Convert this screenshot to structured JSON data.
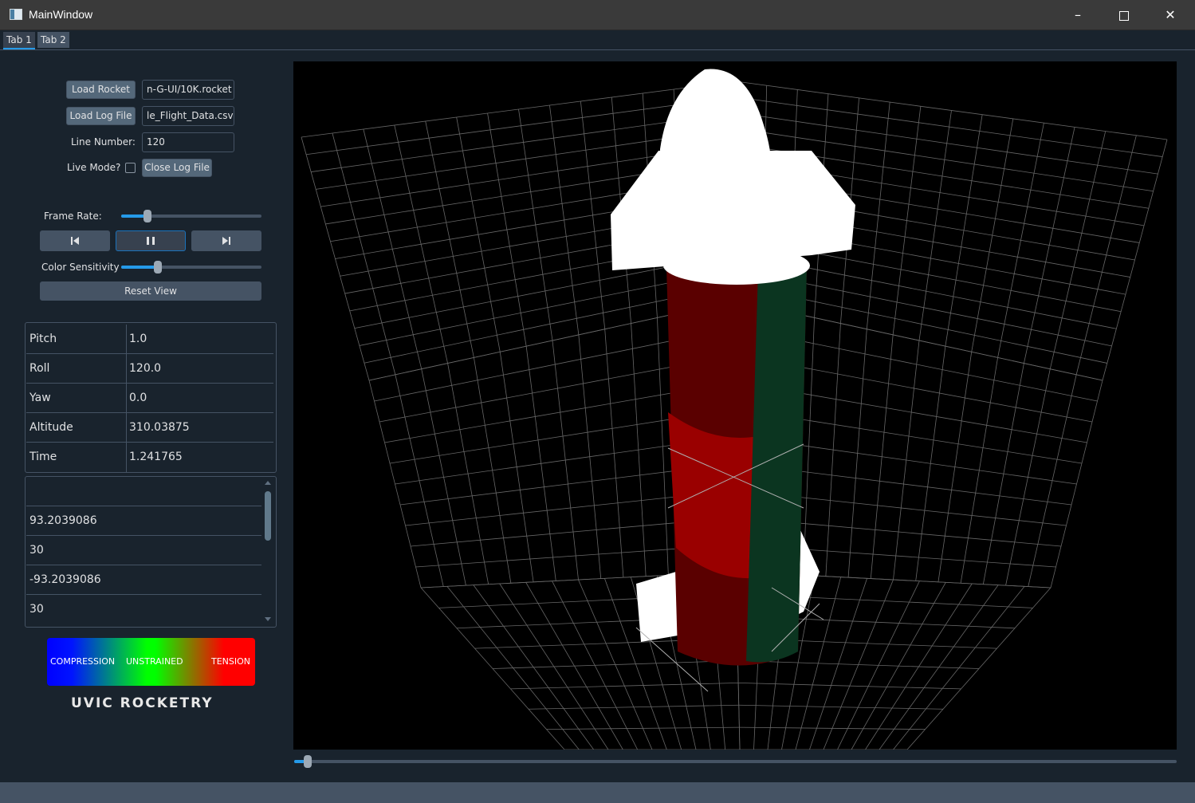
{
  "window": {
    "title": "MainWindow"
  },
  "tabs": [
    {
      "label": "Tab 1",
      "active": true
    },
    {
      "label": "Tab 2",
      "active": false
    }
  ],
  "controls": {
    "load_rocket_label": "Load Rocket",
    "rocket_path": "n-G-UI/10K.rocket",
    "load_log_label": "Load Log File",
    "log_path": "le_Flight_Data.csv",
    "line_number_label": "Line Number:",
    "line_number_value": "120",
    "live_mode_label": "Live Mode?",
    "live_mode_checked": false,
    "close_log_label": "Close Log File",
    "frame_rate_label": "Frame Rate:",
    "frame_rate_fraction": 0.19,
    "color_sensitivity_label": "Color Sensitivity",
    "color_sensitivity_fraction": 0.26,
    "reset_view_label": "Reset View",
    "playback_buttons": [
      "skip-back-icon",
      "pause-icon",
      "skip-forward-icon"
    ]
  },
  "telemetry": [
    {
      "key": "Pitch",
      "value": "1.0"
    },
    {
      "key": "Roll",
      "value": "120.0"
    },
    {
      "key": "Yaw",
      "value": "0.0"
    },
    {
      "key": "Altitude",
      "value": "310.03875"
    },
    {
      "key": "Time",
      "value": "1.241765"
    }
  ],
  "strain_list": [
    "",
    "93.2039086",
    "30",
    "-93.2039086",
    "30"
  ],
  "legend": {
    "compression": "COMPRESSION",
    "unstrained": "UNSTRAINED",
    "tension": "TENSION"
  },
  "logo_text": "UVIC ROCKETRY",
  "timeline_fraction": 0.015,
  "colors": {
    "background": "#19232d",
    "accent": "#259ae9",
    "button": "#54687a",
    "border": "#455364",
    "rocket_white": "#ffffff",
    "strain_dark_red": "#5a0000",
    "strain_red": "#9a0000",
    "strain_green": "#0b3520"
  }
}
